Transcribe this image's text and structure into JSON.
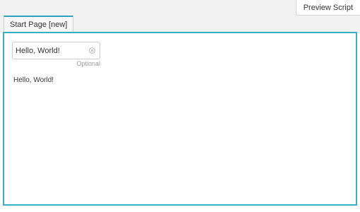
{
  "toolbar": {
    "preview_label": "Preview Script"
  },
  "tabs": [
    {
      "label": "Start Page [new]"
    }
  ],
  "page": {
    "input_value": "Hello, World!",
    "input_hint": "Optional",
    "output_text": "Hello, World!"
  },
  "colors": {
    "accent": "#3aaec6",
    "background": "#f2f2f2"
  }
}
